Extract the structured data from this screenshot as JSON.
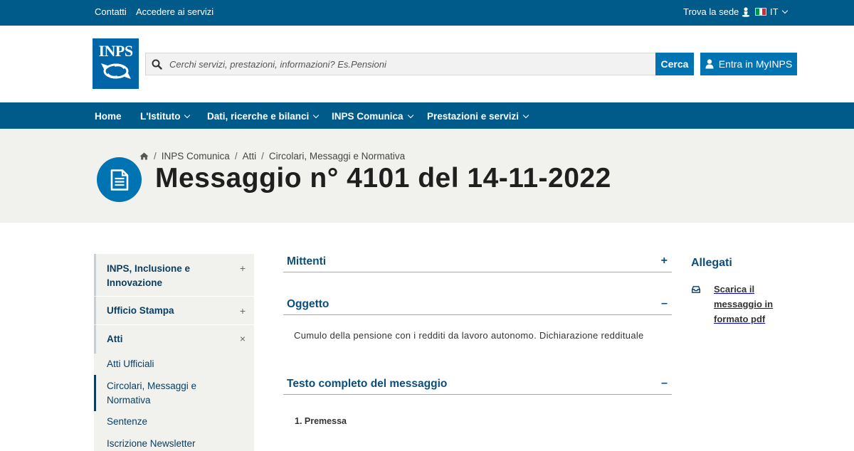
{
  "topbar": {
    "contatti": "Contatti",
    "accedere": "Accedere ai servizi",
    "trova_sede": "Trova la sede",
    "language": "IT"
  },
  "header": {
    "logo_text": "INPS",
    "search_placeholder": "Cerchi servizi, prestazioni, informazioni? Es.Pensioni",
    "search_button": "Cerca",
    "login_button": "Entra in MyINPS"
  },
  "nav": {
    "items": [
      {
        "label": "Home",
        "has_dropdown": false
      },
      {
        "label": "L'Istituto",
        "has_dropdown": true
      },
      {
        "label": "Dati, ricerche e bilanci",
        "has_dropdown": true
      },
      {
        "label": "INPS Comunica",
        "has_dropdown": true
      },
      {
        "label": "Prestazioni e servizi",
        "has_dropdown": true
      }
    ]
  },
  "breadcrumb": {
    "items": [
      "INPS Comunica",
      "Atti",
      "Circolari, Messaggi e Normativa"
    ]
  },
  "page_title": "Messaggio n° 4101 del 14-11-2022",
  "sidebar": {
    "sections": [
      {
        "label": "INPS, Inclusione e Innovazione",
        "toggle": "+"
      },
      {
        "label": "Ufficio Stampa",
        "toggle": "+"
      },
      {
        "label": "Atti",
        "toggle": "×"
      }
    ],
    "subitems": [
      {
        "label": "Atti Ufficiali",
        "active": false
      },
      {
        "label": "Circolari, Messaggi e Normativa",
        "active": true
      },
      {
        "label": "Sentenze",
        "active": false
      },
      {
        "label": "Iscrizione Newsletter",
        "active": false
      }
    ]
  },
  "accordion": [
    {
      "title": "Mittenti",
      "toggle": "+"
    },
    {
      "title": "Oggetto",
      "toggle": "–"
    },
    {
      "title": "Testo completo del messaggio",
      "toggle": "–"
    }
  ],
  "oggetto_text": "Cumulo della pensione con i redditi da lavoro autonomo. Dichiarazione reddituale",
  "premessa": "1. Premessa",
  "allegati": {
    "title": "Allegati",
    "download_label": "Scarica il messaggio in formato pdf"
  },
  "colors": {
    "primary_dark": "#005a8a",
    "primary": "#0074b2",
    "heading_blue": "#0b4e7a",
    "band_bg": "#f1f2ee"
  }
}
